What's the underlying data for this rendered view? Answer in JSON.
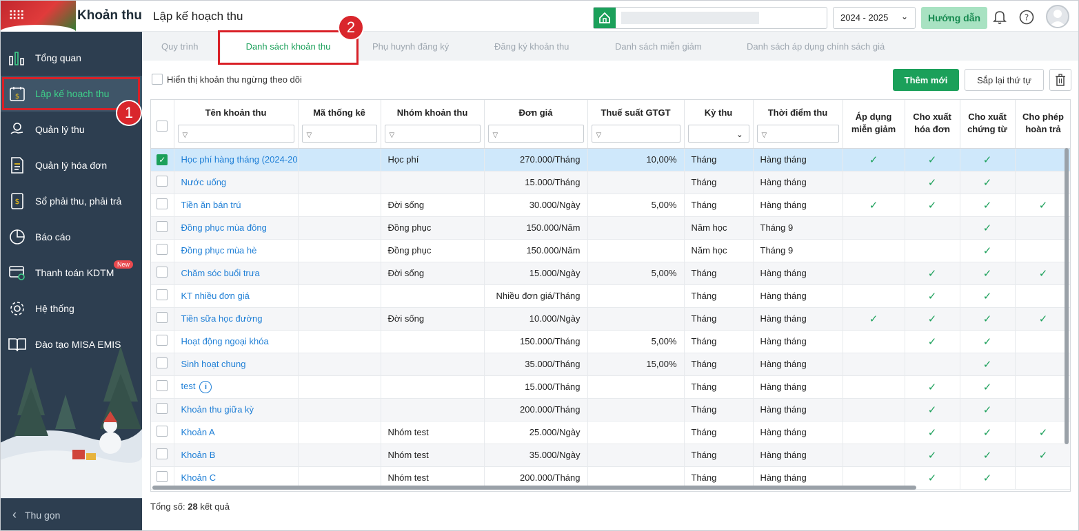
{
  "app": {
    "title": "Khoản thu"
  },
  "sidebar": {
    "items": [
      {
        "label": "Tổng quan",
        "icon": "bar-chart-icon"
      },
      {
        "label": "Lập kế hoạch thu",
        "icon": "calendar-money-icon",
        "active": true
      },
      {
        "label": "Quản lý thu",
        "icon": "coin-hand-icon"
      },
      {
        "label": "Quản lý hóa đơn",
        "icon": "invoice-icon"
      },
      {
        "label": "Sổ phải thu, phải trả",
        "icon": "ledger-icon"
      },
      {
        "label": "Báo cáo",
        "icon": "pie-chart-icon"
      },
      {
        "label": "Thanh toán KDTM",
        "icon": "card-payment-icon",
        "badge": "New"
      },
      {
        "label": "Hệ thống",
        "icon": "gear-icon"
      },
      {
        "label": "Đào tạo MISA EMIS",
        "icon": "book-icon"
      }
    ],
    "collapse_label": "Thu gọn",
    "callout_1": "1"
  },
  "header": {
    "page_title": "Lập kế hoạch thu",
    "year": "2024 - 2025",
    "guide_label": "Hướng dẫn"
  },
  "tabs": {
    "items": [
      "Quy trình",
      "Danh sách khoản thu",
      "Phụ huynh đăng ký",
      "Đăng ký khoản thu",
      "Danh sách miễn giảm",
      "Danh sách áp dụng chính sách giá"
    ],
    "active": "Danh sách khoản thu",
    "callout_2": "2"
  },
  "toolbar": {
    "show_inactive_label": "Hiển thị khoản thu ngừng theo dõi",
    "add_label": "Thêm mới",
    "sort_label": "Sắp lại thứ tự"
  },
  "table": {
    "columns": [
      "Tên khoản thu",
      "Mã thống kê",
      "Nhóm khoản thu",
      "Đơn giá",
      "Thuế suất GTGT",
      "Kỳ thu",
      "Thời điểm thu",
      "Áp dụng miễn giảm",
      "Cho xuất hóa đơn",
      "Cho xuất chứng từ",
      "Cho phép hoàn trả"
    ],
    "rows": [
      {
        "name": "Học phí hàng tháng (2024-20",
        "code": "",
        "group": "Học phí",
        "price": "270.000/Tháng",
        "vat": "10,00%",
        "period": "Tháng",
        "time": "Hàng tháng",
        "discount": true,
        "invoice": true,
        "voucher": true,
        "refund": false,
        "selected": true
      },
      {
        "name": "Nước uống",
        "code": "",
        "group": "",
        "price": "15.000/Tháng",
        "vat": "",
        "period": "Tháng",
        "time": "Hàng tháng",
        "discount": false,
        "invoice": true,
        "voucher": true,
        "refund": false
      },
      {
        "name": "Tiền ăn bán trú",
        "code": "",
        "group": "Đời sống",
        "price": "30.000/Ngày",
        "vat": "5,00%",
        "period": "Tháng",
        "time": "Hàng tháng",
        "discount": true,
        "invoice": true,
        "voucher": true,
        "refund": true
      },
      {
        "name": "Đồng phục mùa đông",
        "code": "",
        "group": "Đồng phục",
        "price": "150.000/Năm",
        "vat": "",
        "period": "Năm học",
        "time": "Tháng 9",
        "discount": false,
        "invoice": false,
        "voucher": true,
        "refund": false
      },
      {
        "name": "Đồng phục mùa hè",
        "code": "",
        "group": "Đồng phục",
        "price": "150.000/Năm",
        "vat": "",
        "period": "Năm học",
        "time": "Tháng 9",
        "discount": false,
        "invoice": false,
        "voucher": true,
        "refund": false
      },
      {
        "name": "Chăm sóc buổi trưa",
        "code": "",
        "group": "Đời sống",
        "price": "15.000/Ngày",
        "vat": "5,00%",
        "period": "Tháng",
        "time": "Hàng tháng",
        "discount": false,
        "invoice": true,
        "voucher": true,
        "refund": true
      },
      {
        "name": "KT nhiều đơn giá",
        "code": "",
        "group": "",
        "price": "Nhiều đơn giá/Tháng",
        "vat": "",
        "period": "Tháng",
        "time": "Hàng tháng",
        "discount": false,
        "invoice": true,
        "voucher": true,
        "refund": false
      },
      {
        "name": "Tiền sữa học đường",
        "code": "",
        "group": "Đời sống",
        "price": "10.000/Ngày",
        "vat": "",
        "period": "Tháng",
        "time": "Hàng tháng",
        "discount": true,
        "invoice": true,
        "voucher": true,
        "refund": true
      },
      {
        "name": "Hoạt động ngoại khóa",
        "code": "",
        "group": "",
        "price": "150.000/Tháng",
        "vat": "5,00%",
        "period": "Tháng",
        "time": "Hàng tháng",
        "discount": false,
        "invoice": true,
        "voucher": true,
        "refund": false
      },
      {
        "name": "Sinh hoạt chung",
        "code": "",
        "group": "",
        "price": "35.000/Tháng",
        "vat": "15,00%",
        "period": "Tháng",
        "time": "Hàng tháng",
        "discount": false,
        "invoice": false,
        "voucher": true,
        "refund": false
      },
      {
        "name": "test",
        "code": "",
        "group": "",
        "price": "15.000/Tháng",
        "vat": "",
        "period": "Tháng",
        "time": "Hàng tháng",
        "discount": false,
        "invoice": true,
        "voucher": true,
        "refund": false,
        "info": true
      },
      {
        "name": "Khoản thu giữa kỳ",
        "code": "",
        "group": "",
        "price": "200.000/Tháng",
        "vat": "",
        "period": "Tháng",
        "time": "Hàng tháng",
        "discount": false,
        "invoice": true,
        "voucher": true,
        "refund": false
      },
      {
        "name": "Khoản A",
        "code": "",
        "group": "Nhóm test",
        "price": "25.000/Ngày",
        "vat": "",
        "period": "Tháng",
        "time": "Hàng tháng",
        "discount": false,
        "invoice": true,
        "voucher": true,
        "refund": true
      },
      {
        "name": "Khoản B",
        "code": "",
        "group": "Nhóm test",
        "price": "35.000/Ngày",
        "vat": "",
        "period": "Tháng",
        "time": "Hàng tháng",
        "discount": false,
        "invoice": true,
        "voucher": true,
        "refund": true
      },
      {
        "name": "Khoản C",
        "code": "",
        "group": "Nhóm test",
        "price": "200.000/Tháng",
        "vat": "",
        "period": "Tháng",
        "time": "Hàng tháng",
        "discount": false,
        "invoice": true,
        "voucher": true,
        "refund": false
      }
    ]
  },
  "footer": {
    "total_prefix": "Tổng số:",
    "total_count": "28",
    "total_suffix": "kết quả"
  },
  "colors": {
    "sidebar_bg": "#2d3e50",
    "accent_green": "#1ba05a",
    "link_blue": "#1f7fd6",
    "callout_red": "#d92027"
  }
}
